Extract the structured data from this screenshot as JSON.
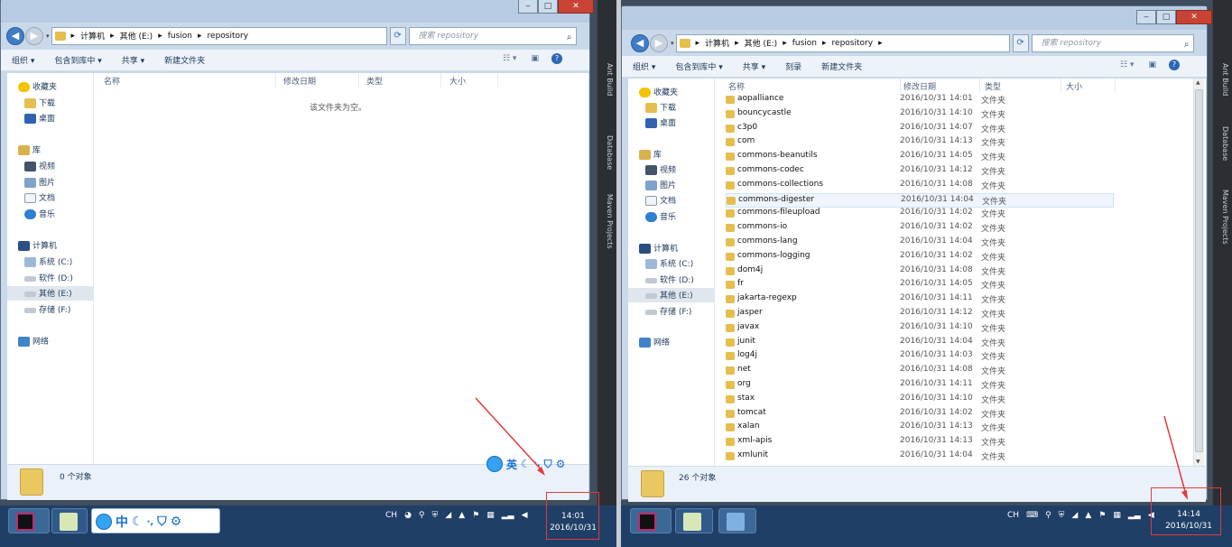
{
  "left": {
    "window": {
      "min": "‒",
      "max": "□",
      "close": "✕"
    },
    "breadcrumb": [
      "计算机",
      "其他 (E:)",
      "fusion",
      "repository"
    ],
    "search_placeholder": "搜索 repository",
    "toolbar": [
      "组织 ▾",
      "包含到库中 ▾",
      "共享 ▾",
      "新建文件夹"
    ],
    "nav": {
      "favorites": "收藏夹",
      "downloads": "下载",
      "desktop": "桌面",
      "libraries": "库",
      "videos": "视频",
      "pictures": "图片",
      "documents": "文档",
      "music": "音乐",
      "computer": "计算机",
      "drive_c": "系统 (C:)",
      "drive_d": "软件 (D:)",
      "drive_e": "其他 (E:)",
      "drive_f": "存储 (F:)",
      "network": "网络"
    },
    "columns": {
      "name": "名称",
      "date": "修改日期",
      "type": "类型",
      "size": "大小"
    },
    "empty_text": "该文件夹为空。",
    "status": "0 个对象",
    "ime": {
      "lang": "英"
    },
    "taskbar_ime": {
      "lang": "中"
    },
    "tray_lang": "CH",
    "clock": {
      "time": "14:01",
      "date": "2016/10/31"
    }
  },
  "right": {
    "window": {
      "min": "‒",
      "max": "□",
      "close": "✕"
    },
    "breadcrumb": [
      "计算机",
      "其他 (E:)",
      "fusion",
      "repository"
    ],
    "search_placeholder": "搜索 repository",
    "toolbar": [
      "组织 ▾",
      "包含到库中 ▾",
      "共享 ▾",
      "刻录",
      "新建文件夹"
    ],
    "nav": {
      "favorites": "收藏夹",
      "downloads": "下载",
      "desktop": "桌面",
      "libraries": "库",
      "videos": "视频",
      "pictures": "图片",
      "documents": "文档",
      "music": "音乐",
      "computer": "计算机",
      "drive_c": "系统 (C:)",
      "drive_d": "软件 (D:)",
      "drive_e": "其他 (E:)",
      "drive_f": "存储 (F:)",
      "network": "网络"
    },
    "columns": {
      "name": "名称",
      "date": "修改日期",
      "type": "类型",
      "size": "大小"
    },
    "files": [
      {
        "name": "aopalliance",
        "date": "2016/10/31 14:01",
        "type": "文件夹"
      },
      {
        "name": "bouncycastle",
        "date": "2016/10/31 14:10",
        "type": "文件夹"
      },
      {
        "name": "c3p0",
        "date": "2016/10/31 14:07",
        "type": "文件夹"
      },
      {
        "name": "com",
        "date": "2016/10/31 14:13",
        "type": "文件夹"
      },
      {
        "name": "commons-beanutils",
        "date": "2016/10/31 14:05",
        "type": "文件夹"
      },
      {
        "name": "commons-codec",
        "date": "2016/10/31 14:12",
        "type": "文件夹"
      },
      {
        "name": "commons-collections",
        "date": "2016/10/31 14:08",
        "type": "文件夹"
      },
      {
        "name": "commons-digester",
        "date": "2016/10/31 14:04",
        "type": "文件夹"
      },
      {
        "name": "commons-fileupload",
        "date": "2016/10/31 14:02",
        "type": "文件夹"
      },
      {
        "name": "commons-io",
        "date": "2016/10/31 14:02",
        "type": "文件夹"
      },
      {
        "name": "commons-lang",
        "date": "2016/10/31 14:04",
        "type": "文件夹"
      },
      {
        "name": "commons-logging",
        "date": "2016/10/31 14:02",
        "type": "文件夹"
      },
      {
        "name": "dom4j",
        "date": "2016/10/31 14:08",
        "type": "文件夹"
      },
      {
        "name": "fr",
        "date": "2016/10/31 14:05",
        "type": "文件夹"
      },
      {
        "name": "jakarta-regexp",
        "date": "2016/10/31 14:11",
        "type": "文件夹"
      },
      {
        "name": "jasper",
        "date": "2016/10/31 14:12",
        "type": "文件夹"
      },
      {
        "name": "javax",
        "date": "2016/10/31 14:10",
        "type": "文件夹"
      },
      {
        "name": "junit",
        "date": "2016/10/31 14:04",
        "type": "文件夹"
      },
      {
        "name": "log4j",
        "date": "2016/10/31 14:03",
        "type": "文件夹"
      },
      {
        "name": "net",
        "date": "2016/10/31 14:08",
        "type": "文件夹"
      },
      {
        "name": "org",
        "date": "2016/10/31 14:11",
        "type": "文件夹"
      },
      {
        "name": "stax",
        "date": "2016/10/31 14:10",
        "type": "文件夹"
      },
      {
        "name": "tomcat",
        "date": "2016/10/31 14:02",
        "type": "文件夹"
      },
      {
        "name": "xalan",
        "date": "2016/10/31 14:13",
        "type": "文件夹"
      },
      {
        "name": "xml-apis",
        "date": "2016/10/31 14:13",
        "type": "文件夹"
      },
      {
        "name": "xmlunit",
        "date": "2016/10/31 14:04",
        "type": "文件夹"
      }
    ],
    "highlighted_row": "commons-digester",
    "status": "26 个对象",
    "tray_lang": "CH",
    "clock": {
      "time": "14:14",
      "date": "2016/10/31"
    }
  },
  "ide_panels": [
    "Ant Build",
    "Database",
    "Maven Projects"
  ],
  "colors": {
    "annotation": "#e23b3b",
    "taskbar": "#1f3f66",
    "folder": "#e5be4f"
  }
}
